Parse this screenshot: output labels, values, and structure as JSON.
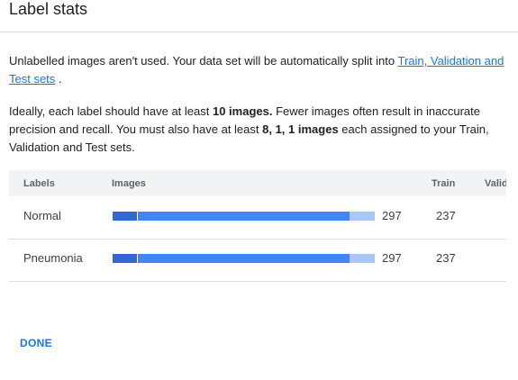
{
  "dialog": {
    "title": "Label stats",
    "intro_text": "Unlabelled images aren't used. Your data set will be automatically split into ",
    "intro_link": "Train, Validation and Test sets",
    "intro_end": " .",
    "req_pre": "Ideally, each label should have at least ",
    "req_bold1": "10 images.",
    "req_mid": " Fewer images often result in inaccurate precision and recall. You must also have at least ",
    "req_bold2": "8, 1, 1 images",
    "req_post": " each assigned to your Train, Validation and Test sets.",
    "done_label": "DONE"
  },
  "table": {
    "headers": {
      "labels": "Labels",
      "images": "Images",
      "train": "Train",
      "validation": "Validation"
    },
    "rows": [
      {
        "label": "Normal",
        "images": "297",
        "train": "237",
        "split_fractions": {
          "train": 0.092,
          "validation": 0.81,
          "test": 0.098
        }
      },
      {
        "label": "Pneumonia",
        "images": "297",
        "train": "237",
        "split_fractions": {
          "train": 0.092,
          "validation": 0.81,
          "test": 0.098
        }
      }
    ]
  },
  "colors": {
    "link": "#1a73e8",
    "bar_train": "#3367d6",
    "bar_validation": "#4285f4",
    "bar_test": "#a8c7fa"
  }
}
